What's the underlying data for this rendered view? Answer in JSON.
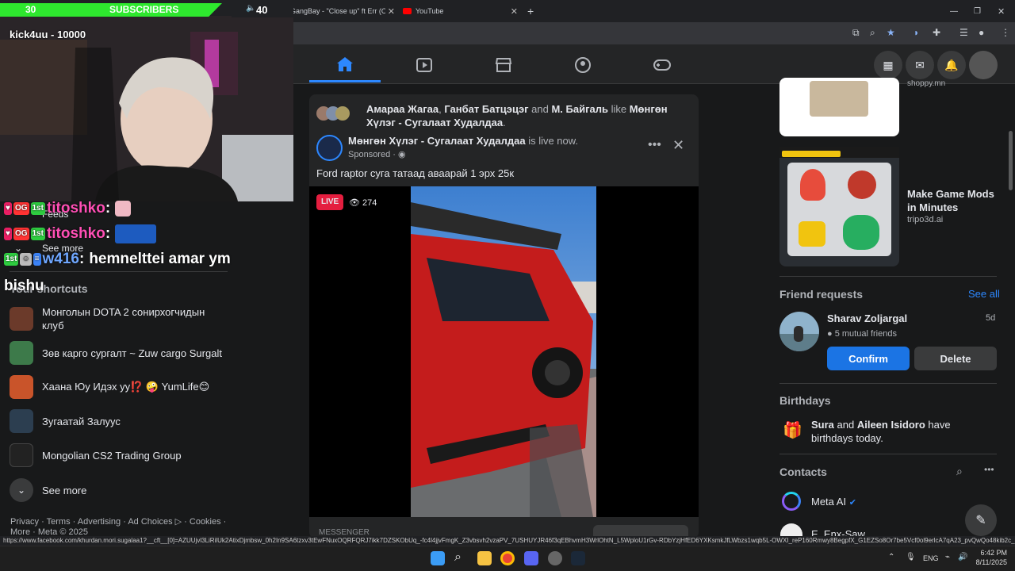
{
  "stream_overlay": {
    "sub_count": "30",
    "sub_label": "SUBSCRIBERS",
    "follower_label": "40",
    "streamer_name": "kick4uu - 10000",
    "chat": [
      {
        "user": "titoshko",
        "msg": ""
      },
      {
        "user": "titoshko",
        "msg": ""
      },
      {
        "user": "w416",
        "msg": "hemnelttei amar ym"
      },
      {
        "user": "bishu",
        "msg": ""
      }
    ]
  },
  "browser": {
    "tabs": [
      {
        "title": "GangBay - \"Close up\" ft Err (Of"
      },
      {
        "title": "YouTube"
      }
    ],
    "new_tab": "+"
  },
  "left_nav": {
    "feeds": "Feeds",
    "see_more_top": "See more",
    "shortcuts_heading": "Your shortcuts",
    "shortcuts": [
      {
        "label": "Монголын DOTA 2 сонирхогчидын клуб"
      },
      {
        "label": "Зөв карго сургалт ~ Zuw cargo Surgalt"
      },
      {
        "label": "Хаана Юу Идэх уу⁉️ 🤪 YumLife😊"
      },
      {
        "label": "Зугаатай Залуус"
      },
      {
        "label": "Mongolian CS2 Trading Group"
      }
    ],
    "see_more": "See more",
    "footer_line1": "Privacy · Terms · Advertising · Ad Choices ▷ · Cookies ·",
    "footer_line2": "More · Meta © 2025"
  },
  "post": {
    "likers_a": "Амараа Жагаа",
    "likers_sep": ", ",
    "likers_b": "Ганбат Батцэцэг",
    "likers_and": " and ",
    "likers_c": "М. Байгаль",
    "likers_like": " like ",
    "page_name_top": "Мөнгөн Хүлэг - Сугалаат Худалдаа",
    "page_name": "Мөнгөн Хүлэг - Сугалаат Худалдаа",
    "live_now": " is live now.",
    "sponsored": "Sponsored · ",
    "caption": "Ford raptor суга татаад аваарай 1 эрх 25к",
    "live_badge": "LIVE",
    "viewers": "274",
    "messenger": "MESSENGER"
  },
  "right_col": {
    "ad1_domain": "shoppy.mn",
    "ad2_title": "Make Game Mods in Minutes",
    "ad2_domain": "tripo3d.ai",
    "friend_requests": "Friend requests",
    "see_all": "See all",
    "fr_name": "Sharav Zoljargal",
    "fr_time": "5d",
    "fr_mutual": "5 mutual friends",
    "confirm": "Confirm",
    "delete": "Delete",
    "birthdays": "Birthdays",
    "bday_a": "Sura",
    "bday_and": " and ",
    "bday_b": "Aileen Isidoro",
    "bday_rest": " have birthdays today.",
    "contacts": "Contacts",
    "meta_ai": "Meta AI",
    "contact2": "E. Enx-Saw"
  },
  "status_url": "https://www.facebook.com/khurdan.mori.sugalaa1?__cft__[0]=AZUUjvl3LiRilUk2AtixDjmbsw_0h2In9SA6tzxv3tEwFNuxOQRFQRJ7ikk7DZSKObUq_-fc4l4jjvFmgK_Z3vbsvh2vzaPV_7USHUYJR46f3qEBhvmH3WrlOhtN_L5WploU1rGv-RDbYzjHfED6YXKsmkJfLWbzs1wqb5L-OWXI_reP160Rmwy8BegpfX_G1EZSo8Or7be5Vcf0ol9erlcA7qA23_pvQwQo48kib2c_5cLM...",
  "taskbar": {
    "lang": "ENG",
    "time": "6:42 PM",
    "date": "8/11/2025"
  },
  "colors": {
    "fb_blue": "#2d88ff",
    "confirm_blue": "#1b74e4",
    "sub_green": "#2ee82e",
    "live_red": "#e41e3f"
  }
}
